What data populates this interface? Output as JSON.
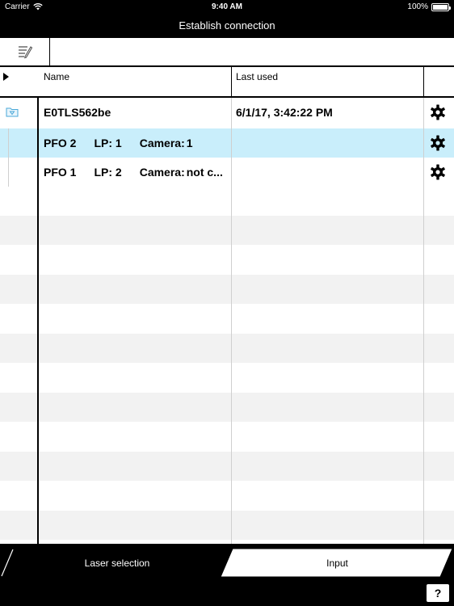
{
  "status_bar": {
    "carrier": "Carrier",
    "time": "9:40 AM",
    "battery": "100%"
  },
  "title": "Establish connection",
  "table": {
    "columns": {
      "name": "Name",
      "last_used": "Last used"
    },
    "device": {
      "name": "E0TLS562be",
      "last_used": "6/1/17, 3:42:22 PM"
    },
    "children": [
      {
        "pfo": "PFO 2",
        "lp": "LP: 1",
        "camera_label": "Camera:",
        "camera_value": "1",
        "selected": true
      },
      {
        "pfo": "PFO 1",
        "lp": "LP: 2",
        "camera_label": "Camera:",
        "camera_value": "not c...",
        "selected": false
      }
    ]
  },
  "tabs": {
    "laser_selection": "Laser selection",
    "input": "Input"
  },
  "help_label": "?",
  "colors": {
    "selected_row": "#c9eefb",
    "stripe": "#f2f2f2",
    "folder_icon": "#4aa8d8"
  },
  "icons": [
    "wifi-icon",
    "battery-icon",
    "edit-list-icon",
    "expand-triangle-icon",
    "folder-icon",
    "gear-icon",
    "help-icon"
  ]
}
